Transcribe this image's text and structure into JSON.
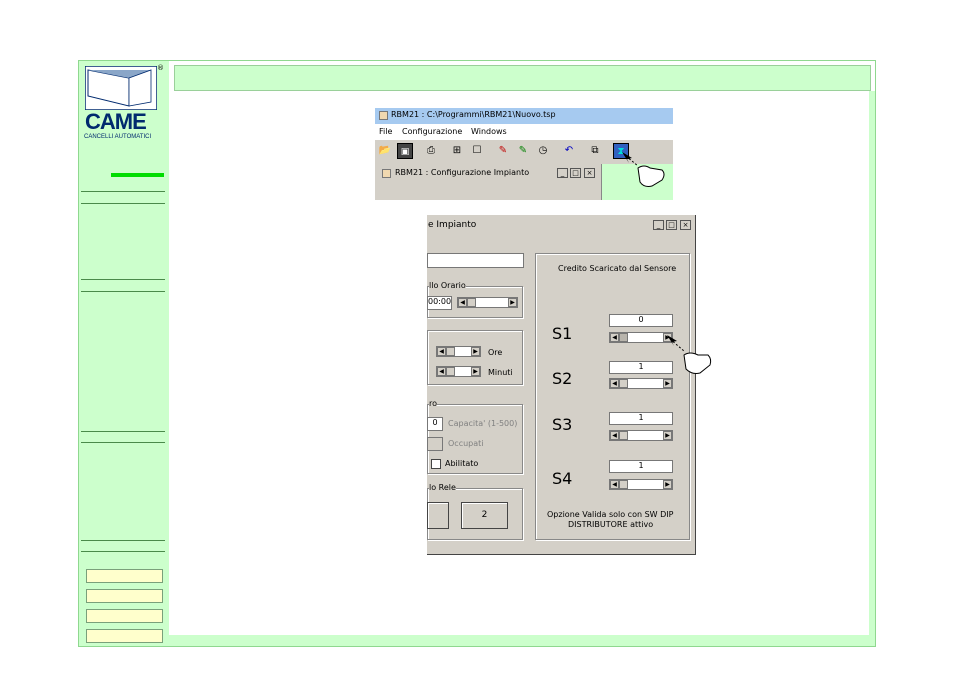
{
  "sidebar": {
    "logo": {
      "text": "CAME",
      "subtitle": "CANCELLI AUTOMATICI",
      "registered": "®"
    },
    "nav_buttons": [
      "",
      "",
      "",
      ""
    ]
  },
  "app_window": {
    "title": "RBM21 : C:\\Programmi\\RBM21\\Nuovo.tsp",
    "menu": [
      "File",
      "Configurazione",
      "Windows"
    ],
    "toolbar_icons": [
      "open-icon",
      "save-icon",
      "print-icon",
      "network-icon",
      "properties-icon",
      "pin-red-icon",
      "pin-green-icon",
      "clock-icon",
      "undo-icon",
      "copy-icon",
      "config-icon"
    ],
    "child_window_title": "RBM21 : Configurazione Impianto"
  },
  "dialog": {
    "title": "e Impianto",
    "group_orario": "llo Orario",
    "orario_value": "00:00",
    "label_ore": "Ore",
    "label_minuti": "Minuti",
    "group_ro": "ro",
    "capacita_value": "0",
    "label_capacita": "Capacita' (1-500)",
    "label_occupati": "Occupati",
    "label_abilitato": "Abilitato",
    "group_rele": "lo Rele",
    "button_2": "2",
    "sensor_group_title": "Credito Scaricato dal Sensore",
    "sensors": [
      {
        "label": "S1",
        "value": "0"
      },
      {
        "label": "S2",
        "value": "1"
      },
      {
        "label": "S3",
        "value": "1"
      },
      {
        "label": "S4",
        "value": "1"
      }
    ],
    "note_line1": "Opzione Valida solo con SW DIP",
    "note_line2": "DISTRIBUTORE attivo"
  },
  "colors": {
    "sidebar_bg": "#ccffcc",
    "accent_green": "#00dd00",
    "titlebar_bg": "#a6caf0",
    "dialog_bg": "#d4d0c8"
  }
}
